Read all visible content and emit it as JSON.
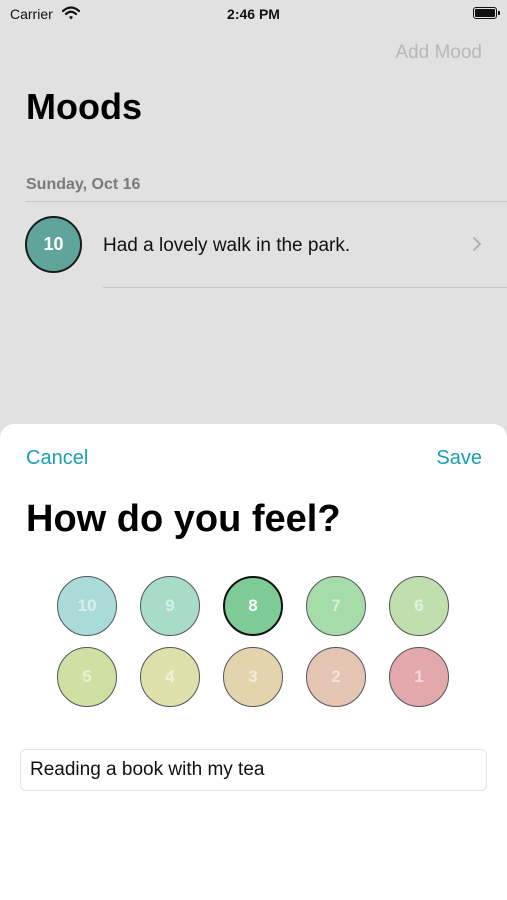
{
  "status_bar": {
    "carrier": "Carrier",
    "time": "2:46 PM"
  },
  "header": {
    "add_label": "Add Mood",
    "title": "Moods"
  },
  "list": {
    "section": "Sunday, Oct 16",
    "entries": [
      {
        "rating": "10",
        "note": "Had a lovely walk in the park.",
        "color": "#5fa59b"
      }
    ]
  },
  "sheet": {
    "cancel_label": "Cancel",
    "save_label": "Save",
    "title": "How do you feel?",
    "accent": "#1aa0b6",
    "selected": "8",
    "moods": [
      {
        "value": "10",
        "color": "#a9dcd8"
      },
      {
        "value": "9",
        "color": "#a6dcc8"
      },
      {
        "value": "8",
        "color": "#7ecb97"
      },
      {
        "value": "7",
        "color": "#a6dca9"
      },
      {
        "value": "6",
        "color": "#bfe0ae"
      },
      {
        "value": "5",
        "color": "#cfe0a5"
      },
      {
        "value": "4",
        "color": "#dfe1ad"
      },
      {
        "value": "3",
        "color": "#e3d4ae"
      },
      {
        "value": "2",
        "color": "#e4c4b2"
      },
      {
        "value": "1",
        "color": "#e2a8ac"
      }
    ],
    "note_value": "Reading a book with my tea"
  }
}
